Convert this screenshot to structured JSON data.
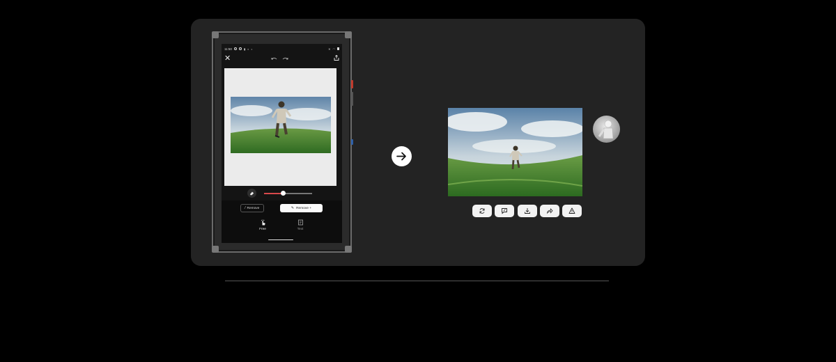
{
  "phone": {
    "status": {
      "time": "11:50"
    },
    "modes": [
      {
        "label": "Free",
        "icon": "hand-pointer-icon",
        "active": true
      },
      {
        "label": "Text",
        "icon": "text-document-icon",
        "active": false
      }
    ],
    "buttons": {
      "remove_label": "Remove",
      "remove_plus_label": "Remove +"
    },
    "brush_size": 0.4
  },
  "result_actions": [
    {
      "name": "regenerate-button",
      "icon": "refresh-icon"
    },
    {
      "name": "feedback-button",
      "icon": "chat-edit-icon"
    },
    {
      "name": "download-button",
      "icon": "download-icon"
    },
    {
      "name": "share-button",
      "icon": "share-arrow-icon"
    },
    {
      "name": "report-button",
      "icon": "warning-icon"
    }
  ],
  "colors": {
    "panel": "#232323",
    "slider_accent": "#d8494c",
    "sky_top": "#6f93b5",
    "grass": "#3f7f2e"
  }
}
